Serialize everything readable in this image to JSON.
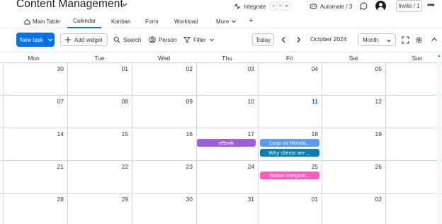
{
  "header": {
    "title": "Content Management",
    "integrate_label": "Integrate",
    "automate_label": "Automate / 3",
    "invite_label": "Invite / 1",
    "more_icon": "•••"
  },
  "tabs": [
    {
      "label": "Main Table",
      "icon": "home-icon"
    },
    {
      "label": "Calendar"
    },
    {
      "label": "Kanban"
    },
    {
      "label": "Form"
    },
    {
      "label": "Workload"
    },
    {
      "label": "More"
    }
  ],
  "tab_add_label": "+",
  "toolbar": {
    "new_task_label": "New task",
    "add_widget_label": "Add widget",
    "search_label": "Search",
    "person_label": "Person",
    "filter_label": "Filter",
    "today_label": "Today",
    "current_month": "October 2024",
    "view_label": "Month"
  },
  "calendar": {
    "weekdays": [
      "Mon",
      "Tue",
      "Wed",
      "Thu",
      "Fri",
      "Sat",
      "Sun"
    ],
    "weeks": [
      [
        "30",
        "01",
        "02",
        "03",
        "04",
        "05",
        ""
      ],
      [
        "07",
        "08",
        "09",
        "10",
        "11",
        "12",
        ""
      ],
      [
        "14",
        "15",
        "16",
        "17",
        "18",
        "19",
        ""
      ],
      [
        "21",
        "22",
        "23",
        "24",
        "25",
        "26",
        ""
      ],
      [
        "28",
        "29",
        "30",
        "31",
        "01",
        "02",
        ""
      ]
    ],
    "today": "11",
    "events": [
      {
        "label": "eBook",
        "color": "#a25ddc"
      },
      {
        "label": "Loop vs Monda...",
        "color": "#579bfc"
      },
      {
        "label": "Why clients are ...",
        "color": "#007eb5"
      },
      {
        "label": "Notion integrati...",
        "color": "#ff5ac4"
      }
    ]
  },
  "colors": {
    "accent": "#0073ea",
    "border": "#d0d4e4",
    "text": "#323338"
  }
}
